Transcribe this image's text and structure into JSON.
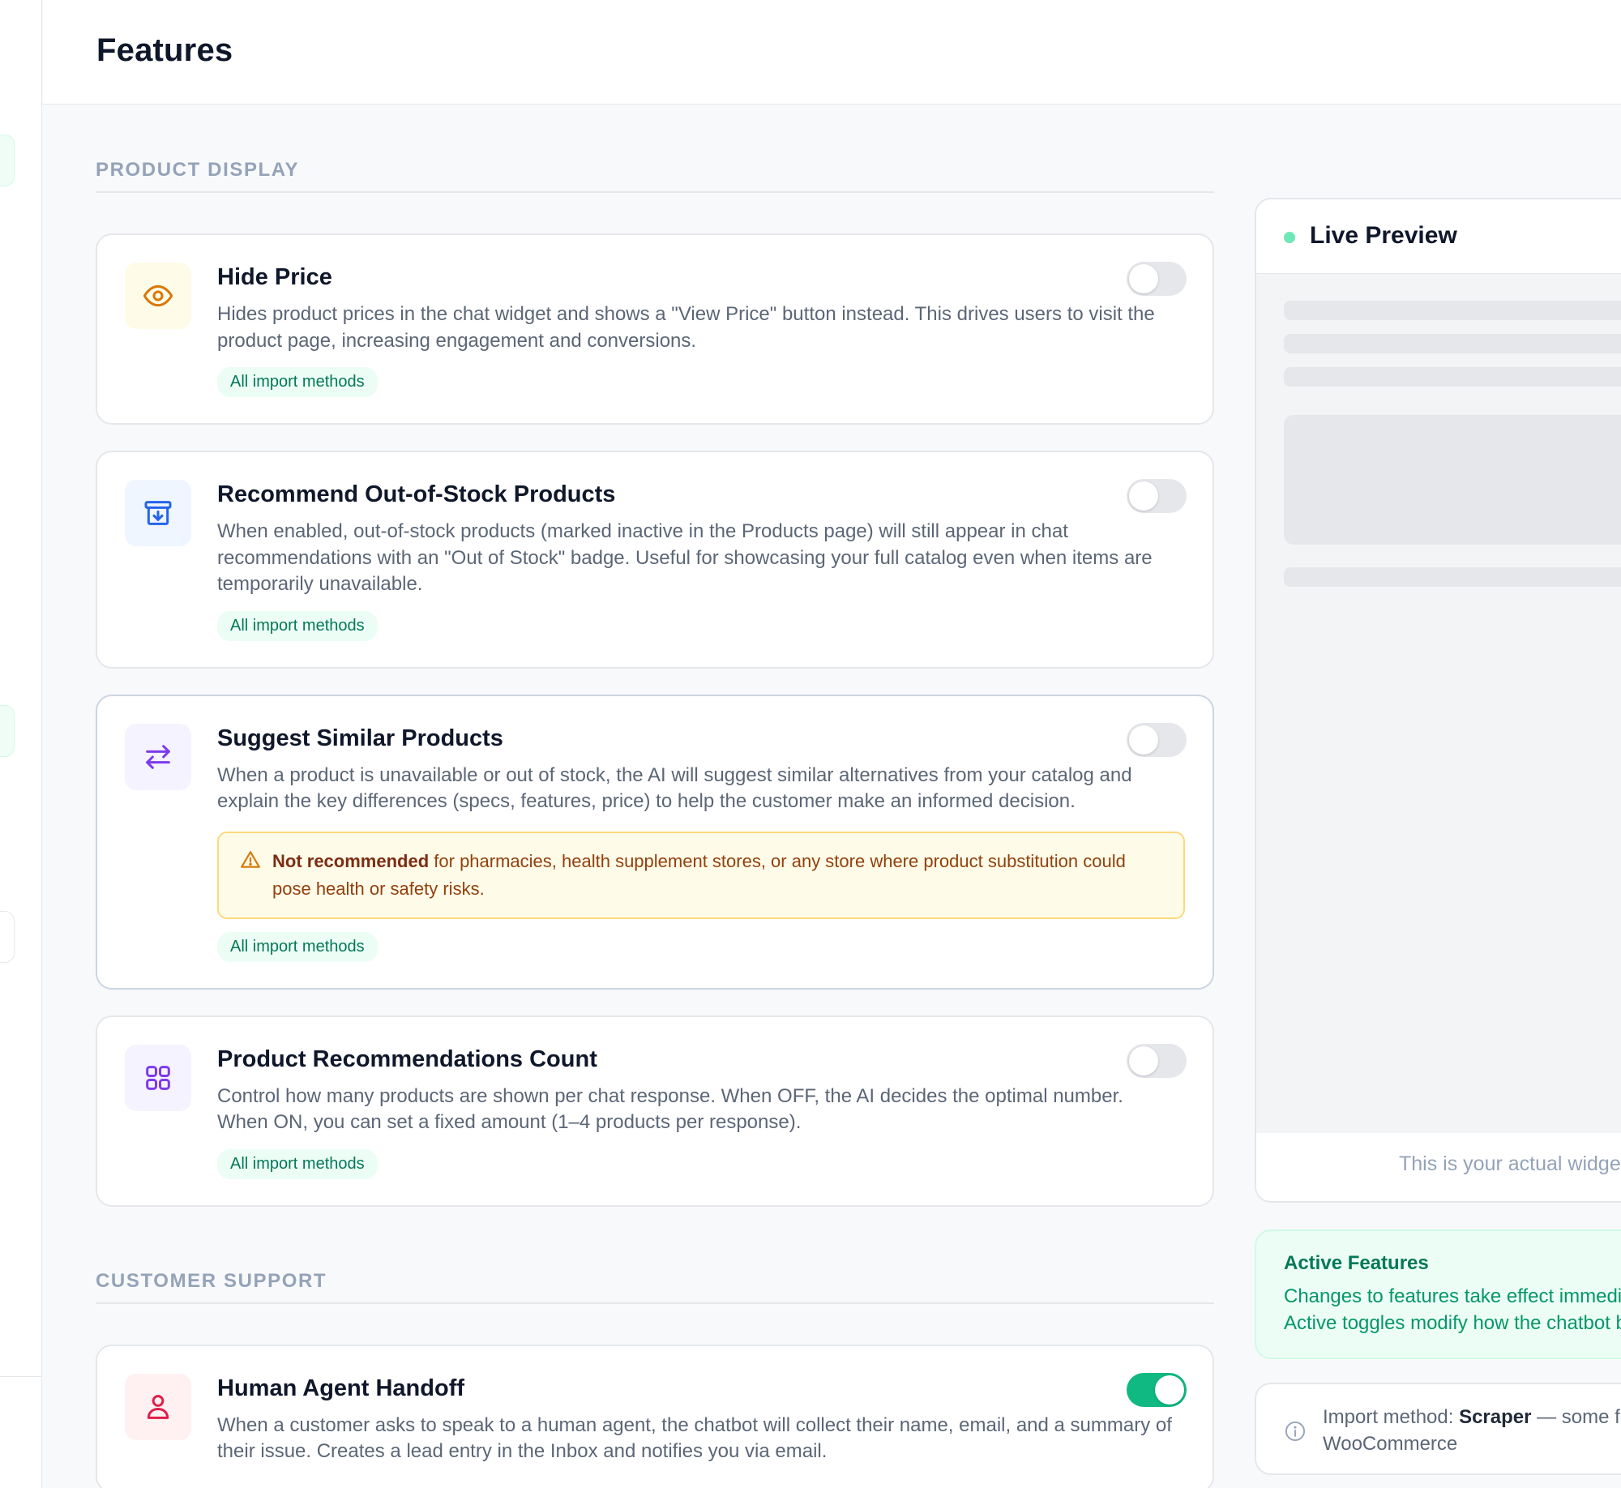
{
  "page": {
    "title": "Features"
  },
  "sections": [
    {
      "label": "PRODUCT DISPLAY",
      "features": [
        {
          "title": "Hide Price",
          "description": "Hides product prices in the chat widget and shows a \"View Price\" button instead. This drives users to visit the product page, increasing engagement and conversions.",
          "badge": "All import methods",
          "enabled": false,
          "icon": "eye-icon",
          "icon_color": "#d97706",
          "icon_bg": "#fefce8"
        },
        {
          "title": "Recommend Out-of-Stock Products",
          "description": "When enabled, out-of-stock products (marked inactive in the Products page) will still appear in chat recommendations with an \"Out of Stock\" badge. Useful for showcasing your full catalog even when items are temporarily unavailable.",
          "badge": "All import methods",
          "enabled": false,
          "icon": "archive-download-icon",
          "icon_color": "#2563eb",
          "icon_bg": "#eff6ff"
        },
        {
          "title": "Suggest Similar Products",
          "description": "When a product is unavailable or out of stock, the AI will suggest similar alternatives from your catalog and explain the key differences (specs, features, price) to help the customer make an informed decision.",
          "warning_strong": "Not recommended",
          "warning_text": "for pharmacies, health supplement stores, or any store where product substitution could pose health or safety risks.",
          "badge": "All import methods",
          "enabled": false,
          "icon": "swap-arrows-icon",
          "icon_color": "#7c3aed",
          "icon_bg": "#f5f3ff"
        },
        {
          "title": "Product Recommendations Count",
          "description": "Control how many products are shown per chat response. When OFF, the AI decides the optimal number. When ON, you can set a fixed amount (1–4 products per response).",
          "badge": "All import methods",
          "enabled": false,
          "icon": "grid-icon",
          "icon_color": "#7c3aed",
          "icon_bg": "#f5f3ff"
        }
      ]
    },
    {
      "label": "CUSTOMER SUPPORT",
      "features": [
        {
          "title": "Human Agent Handoff",
          "description": "When a customer asks to speak to a human agent, the chatbot will collect their name, email, and a summary of their issue. Creates a lead entry in the Inbox and notifies you via email.",
          "enabled": true,
          "icon": "user-icon",
          "icon_color": "#e11d48",
          "icon_bg": "#fff1f2"
        }
      ]
    }
  ],
  "preview": {
    "title": "Live Preview",
    "footer": "This is your actual widget"
  },
  "active_features": {
    "title": "Active Features",
    "line1": "Changes to features take effect immediately.",
    "line2": "Active toggles modify how the chatbot behaves."
  },
  "import_info": {
    "label": "Import method:",
    "method": "Scraper",
    "suffix": "— some features may differ for",
    "line2": "WooCommerce"
  },
  "colors": {
    "accent": "#10b981",
    "badge_text": "#047857",
    "warning_bg": "#fefbe8"
  }
}
